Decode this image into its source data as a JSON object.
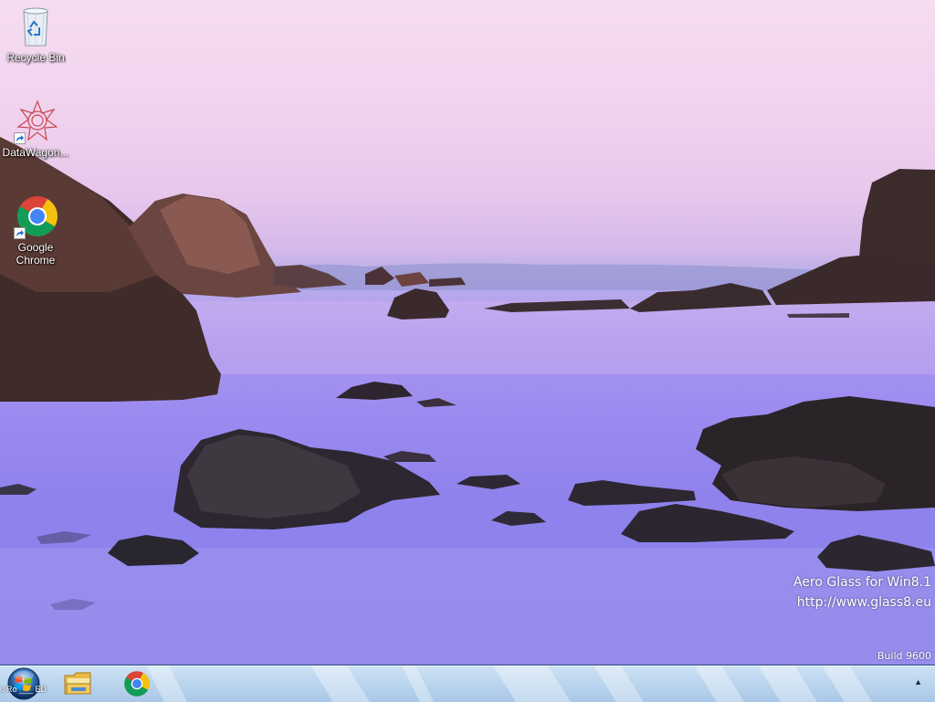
{
  "desktop": {
    "icons": [
      {
        "label": "Recycle Bin",
        "icon": "recycle-bin-icon"
      },
      {
        "label": "DataWagon...",
        "icon": "datawagon-icon"
      },
      {
        "label": "Google Chrome",
        "icon": "chrome-icon"
      }
    ]
  },
  "watermark": {
    "line1": "Aero Glass for Win8.1",
    "line2": "http://www.glass8.eu",
    "build": "Build 9600"
  },
  "taskbar": {
    "start_overlay_text": "c Ro ___ ED",
    "pinned": [
      {
        "icon": "file-explorer-icon"
      },
      {
        "icon": "chrome-icon"
      }
    ],
    "tray_arrow": "▲"
  },
  "colors": {
    "sky_top": "#f6dcf0",
    "water": "#8f82ec",
    "taskbar": "#bcd6ee"
  }
}
